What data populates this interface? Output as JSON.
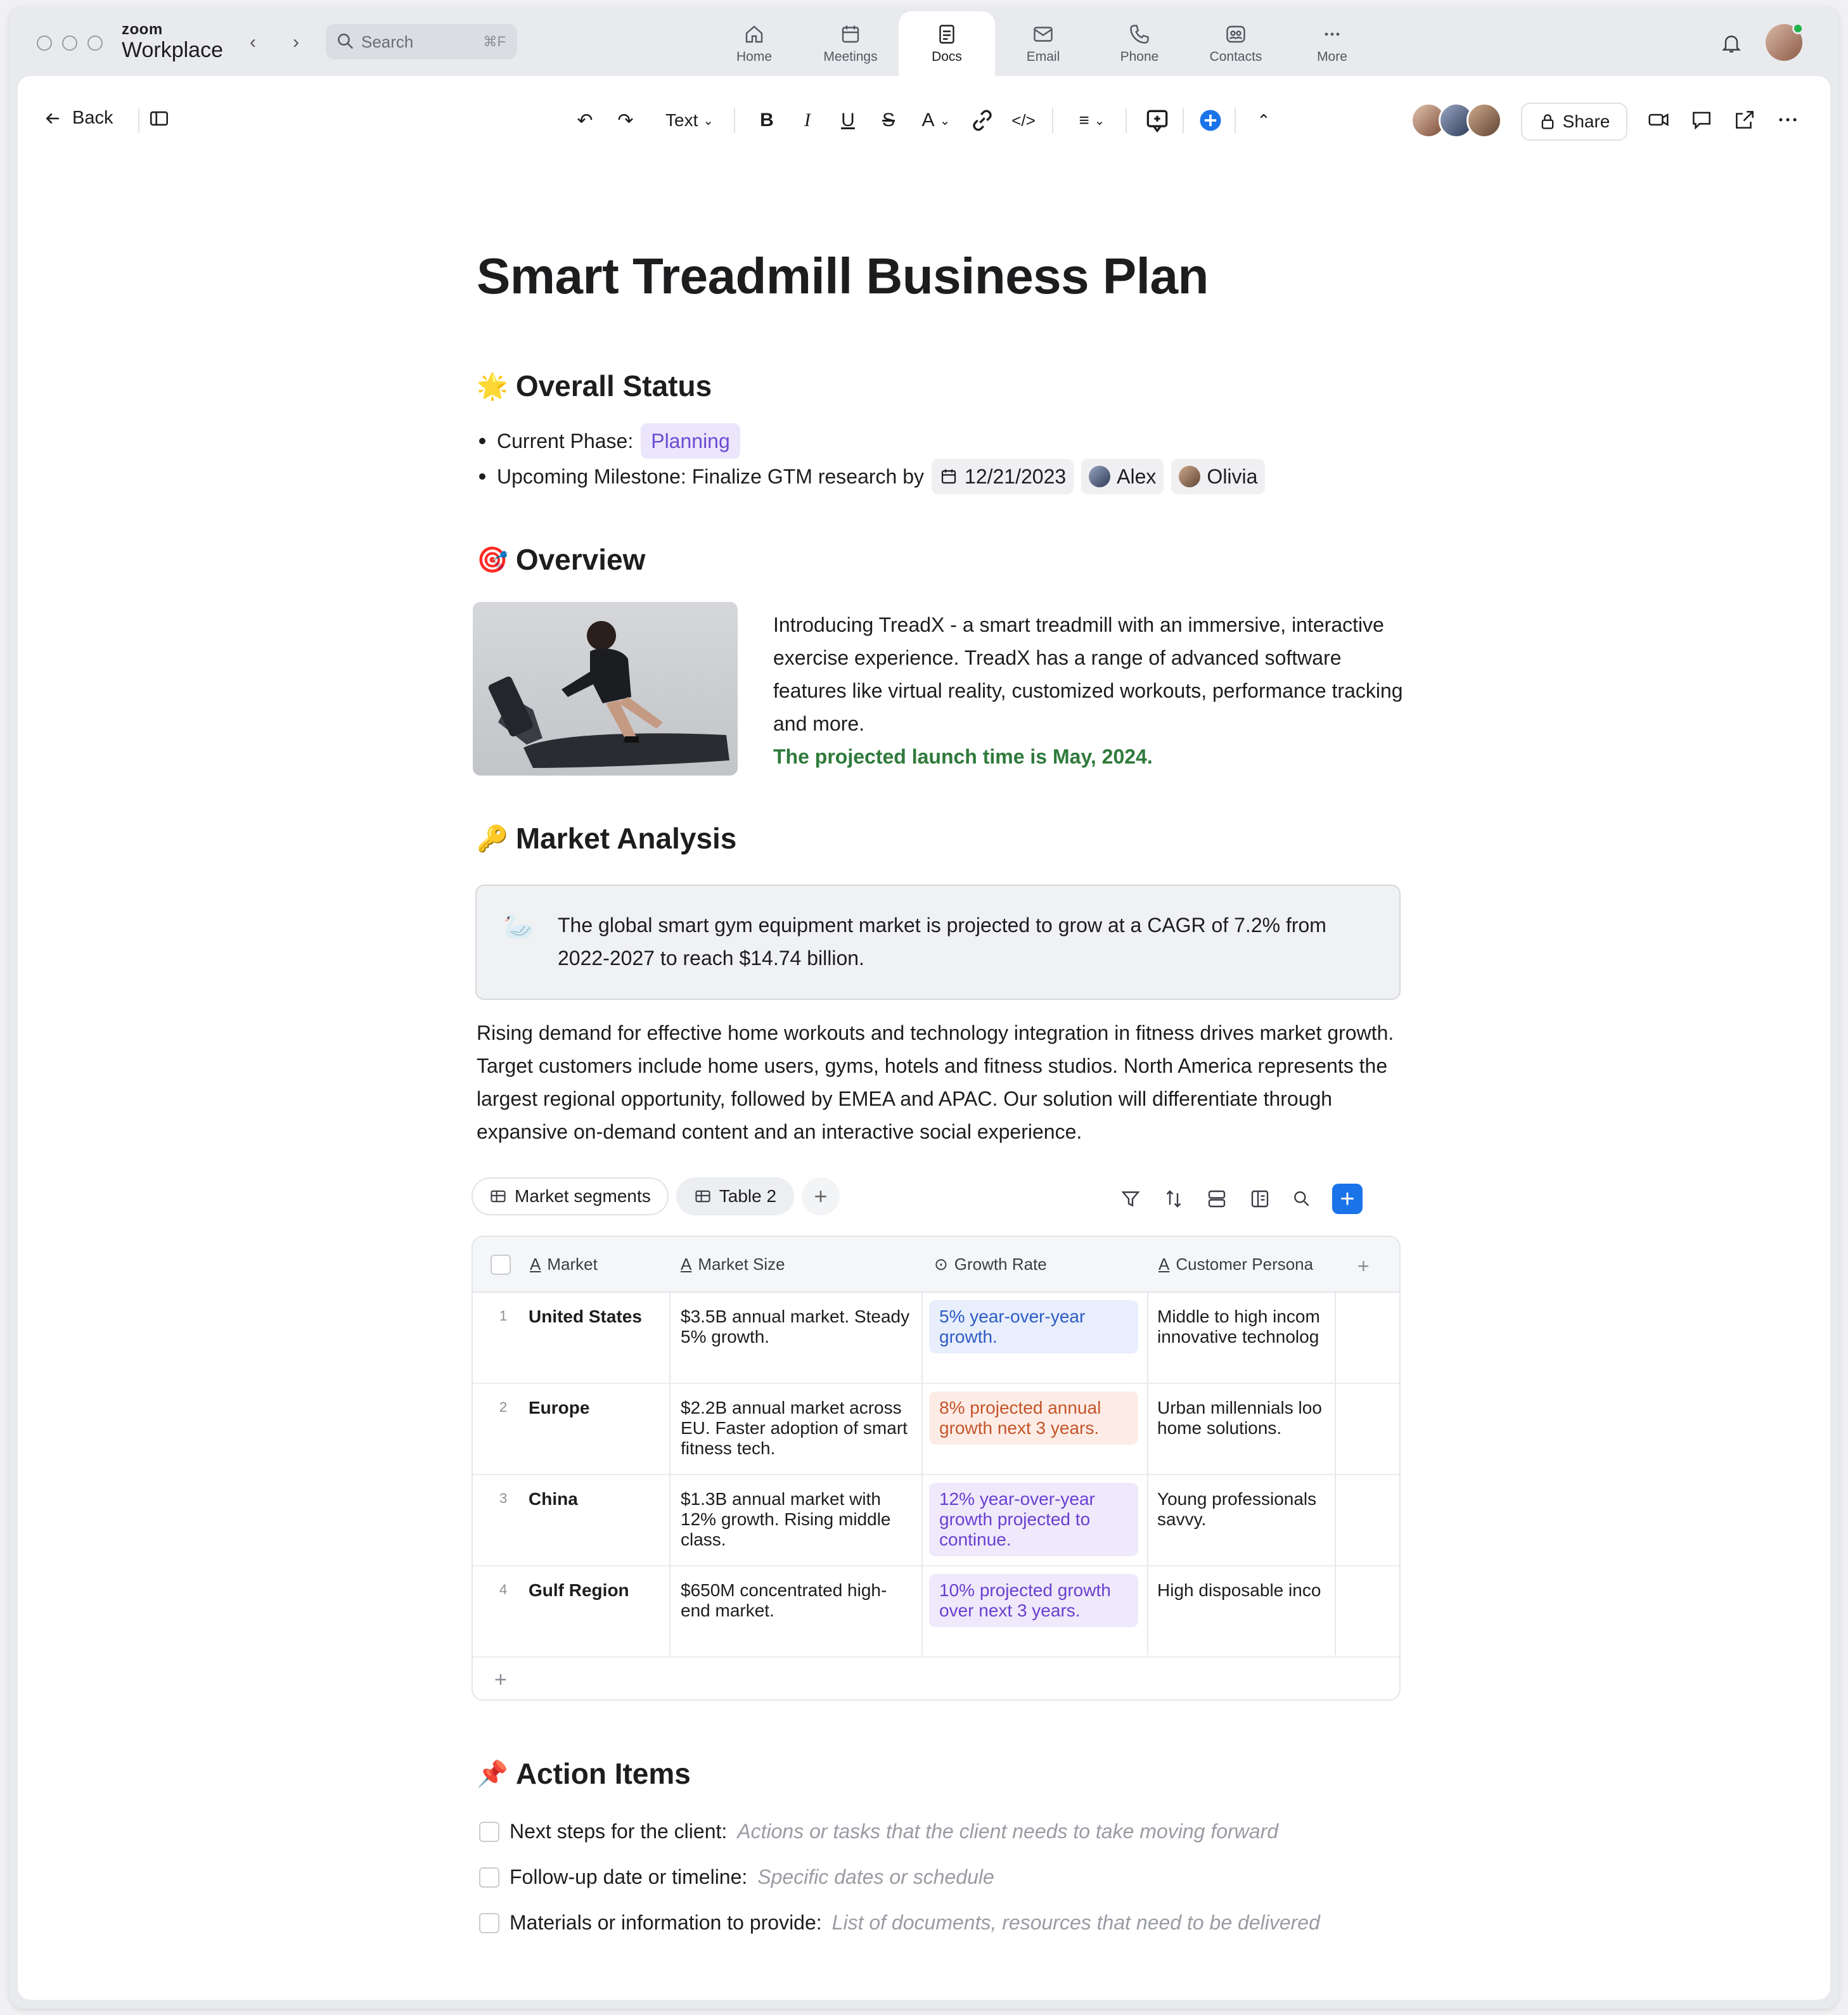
{
  "app": {
    "brand_small": "zoom",
    "brand_large": "Workplace"
  },
  "search": {
    "placeholder": "Search",
    "shortcut": "⌘F"
  },
  "nav_tabs": [
    {
      "label": "Home",
      "icon": "home-icon"
    },
    {
      "label": "Meetings",
      "icon": "calendar-icon"
    },
    {
      "label": "Docs",
      "icon": "doc-icon",
      "active": true
    },
    {
      "label": "Email",
      "icon": "mail-icon"
    },
    {
      "label": "Phone",
      "icon": "phone-icon"
    },
    {
      "label": "Contacts",
      "icon": "contacts-icon"
    },
    {
      "label": "More",
      "icon": "more-icon"
    }
  ],
  "toolbar": {
    "back_label": "Back",
    "text_style": "Text",
    "font_color": "A",
    "share_label": "Share"
  },
  "doc": {
    "title": "Smart Treadmill Business Plan",
    "status": {
      "heading": "Overall Status",
      "emoji": "🌟",
      "phase_label": "Current Phase:",
      "phase_value": "Planning",
      "milestone_label": "Upcoming Milestone: Finalize GTM research by",
      "milestone_date": "12/21/2023",
      "assignees": [
        "Alex",
        "Olivia"
      ]
    },
    "overview": {
      "heading": "Overview",
      "emoji": "🎯",
      "body": "Introducing TreadX - a smart treadmill with an immersive, interactive exercise experience. TreadX has a range of advanced software features like virtual reality, customized workouts, performance tracking and more.",
      "highlight": "The projected launch time is May, 2024."
    },
    "market": {
      "heading": "Market Analysis",
      "emoji": "🔑",
      "callout_emoji": "🦢",
      "callout": "The global smart gym equipment market is projected to grow at a CAGR of 7.2% from 2022-2027 to reach $14.74 billion.",
      "paragraph": "Rising demand for effective home workouts and technology integration in fitness drives market growth. Target customers include home users, gyms, hotels and fitness studios. North America represents the largest regional opportunity, followed by EMEA and APAC. Our solution will differentiate through expansive on-demand content and an interactive social experience."
    },
    "table": {
      "tabs": [
        "Market segments",
        "Table 2"
      ],
      "columns": [
        "Market",
        "Market Size",
        "Growth Rate",
        "Customer Persona"
      ],
      "rows": [
        {
          "num": "1",
          "market": "United States",
          "size": "$3.5B annual market. Steady 5% growth.",
          "growth": "5% year-over-year growth.",
          "persona": "Middle to high incom innovative technolog"
        },
        {
          "num": "2",
          "market": "Europe",
          "size": "$2.2B annual market across EU. Faster adoption of smart fitness tech.",
          "growth": "8% projected annual growth next 3 years.",
          "persona": "Urban millennials loo home solutions."
        },
        {
          "num": "3",
          "market": "China",
          "size": "$1.3B annual market with 12% growth. Rising middle class.",
          "growth": "12% year-over-year growth projected to continue.",
          "persona": "Young professionals savvy."
        },
        {
          "num": "4",
          "market": "Gulf Region",
          "size": "$650M concentrated high-end market.",
          "growth": "10% projected growth over next 3 years.",
          "persona": "High disposable inco"
        }
      ],
      "growth_colors": [
        {
          "bg": "#e8eefc",
          "fg": "#2c5bc4"
        },
        {
          "bg": "#fdece6",
          "fg": "#c4552a"
        },
        {
          "bg": "#efe9fb",
          "fg": "#6a3fcf"
        },
        {
          "bg": "#efe9fb",
          "fg": "#6a3fcf"
        }
      ]
    },
    "actions": {
      "heading": "Action Items",
      "emoji": "📌",
      "items": [
        {
          "label": "Next steps for the client:",
          "placeholder": "Actions or tasks that the client needs to take moving forward"
        },
        {
          "label": "Follow-up date or timeline:",
          "placeholder": "Specific dates or schedule"
        },
        {
          "label": "Materials or information to provide:",
          "placeholder": "List of documents, resources that need to be delivered"
        }
      ]
    }
  }
}
